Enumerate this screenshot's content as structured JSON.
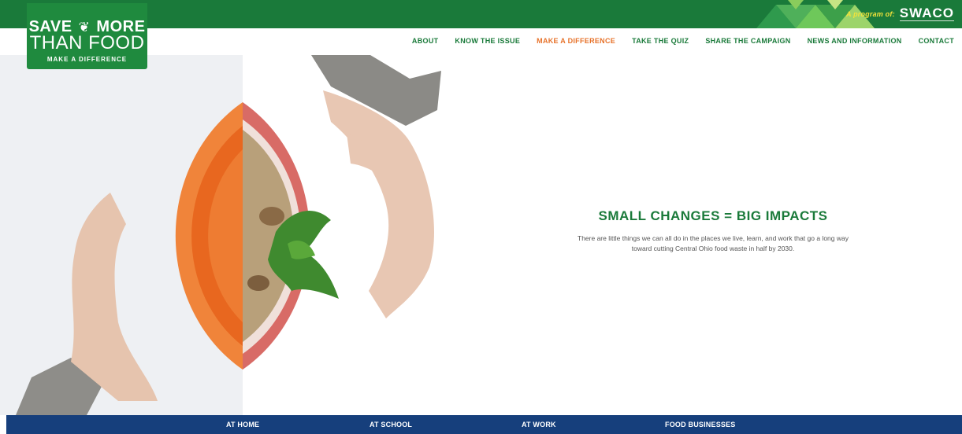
{
  "header": {
    "program_label": "A program of:",
    "partner_logo_text": "SWACO",
    "colors": {
      "green": "#1a7a3a",
      "orange": "#e7722a",
      "navy": "#163f7c"
    }
  },
  "logo": {
    "line1_a": "SAVE",
    "line1_b": "MORE",
    "line2": "THAN FOOD",
    "line3": "MAKE A DIFFERENCE",
    "icon": "leaf-icon"
  },
  "nav": {
    "items": [
      {
        "label": "ABOUT"
      },
      {
        "label": "KNOW THE ISSUE"
      },
      {
        "label": "MAKE A DIFFERENCE"
      },
      {
        "label": "TAKE THE QUIZ"
      },
      {
        "label": "SHARE THE CAMPAIGN"
      },
      {
        "label": "NEWS AND INFORMATION"
      },
      {
        "label": "CONTACT"
      }
    ],
    "active_label": "MAKE A DIFFERENCE"
  },
  "hero": {
    "headline": "SMALL CHANGES = BIG IMPACTS",
    "subtext": "There are little things we can all do in the places we live, learn, and work that go a long way toward cutting Central Ohio food waste in half by 2030."
  },
  "bottom_nav": {
    "items": [
      {
        "label": "AT HOME"
      },
      {
        "label": "AT SCHOOL"
      },
      {
        "label": "AT WORK"
      },
      {
        "label": "FOOD BUSINESSES"
      }
    ]
  }
}
